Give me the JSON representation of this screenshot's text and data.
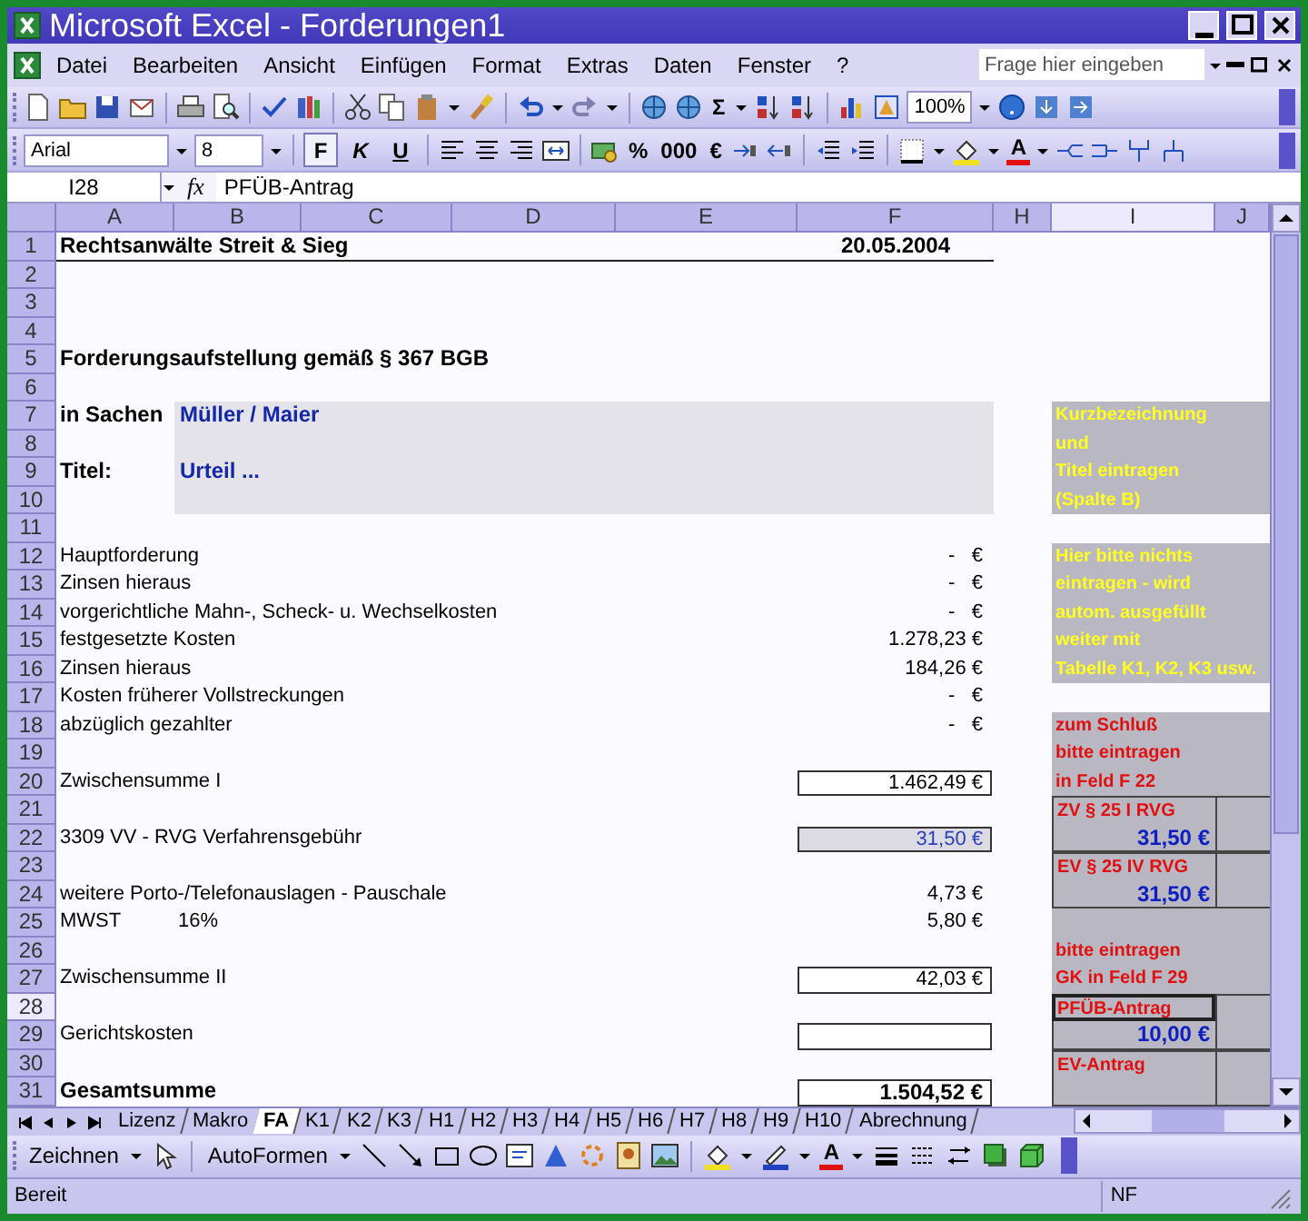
{
  "window": {
    "title": "Microsoft Excel - Forderungen1"
  },
  "menu": [
    "Datei",
    "Bearbeiten",
    "Ansicht",
    "Einfügen",
    "Format",
    "Extras",
    "Daten",
    "Fenster",
    "?"
  ],
  "help_search": {
    "placeholder": "Frage hier eingeben"
  },
  "standard_toolbar": {
    "sum": "Σ",
    "zoom": "100%"
  },
  "formatting_toolbar": {
    "font": "Arial",
    "size": "8",
    "bold": "F",
    "italic": "K",
    "underline": "U",
    "percent": "%",
    "thousands": "000",
    "euro": "€",
    "font_color": "A"
  },
  "formula_bar": {
    "cell": "I28",
    "fx": "fx",
    "content": "PFÜB-Antrag"
  },
  "sheet": {
    "columns": [
      {
        "label": "A",
        "selected": false
      },
      {
        "label": "B",
        "selected": false
      },
      {
        "label": "C",
        "selected": false
      },
      {
        "label": "D",
        "selected": false
      },
      {
        "label": "E",
        "selected": false
      },
      {
        "label": "F",
        "selected": false
      },
      {
        "label": "H",
        "selected": false
      },
      {
        "label": "I",
        "selected": true
      },
      {
        "label": "J",
        "selected": false
      }
    ],
    "rows": [
      {
        "label": "1",
        "selected": false,
        "a": {
          "text": "Rechtsanwälte Streit & Sieg",
          "kind": "title"
        },
        "f": {
          "text": "20.05.2004",
          "kind": "date"
        }
      },
      {
        "label": "2",
        "selected": false
      },
      {
        "label": "3",
        "selected": false
      },
      {
        "label": "4",
        "selected": false
      },
      {
        "label": "5",
        "selected": false,
        "a": {
          "text": "Forderungsaufstellung gemäß § 367 BGB",
          "kind": "bold"
        }
      },
      {
        "label": "6",
        "selected": false
      },
      {
        "label": "7",
        "selected": false,
        "a": {
          "text": "in Sachen",
          "kind": "bold"
        },
        "b": {
          "text": "Müller / Maier",
          "kind": "entry"
        },
        "i": {
          "text": "Kurzbezeichnung",
          "kind": "yellow"
        }
      },
      {
        "label": "8",
        "selected": false,
        "b": {
          "kind": "entry"
        },
        "i": {
          "text": "und",
          "kind": "yellow"
        }
      },
      {
        "label": "9",
        "selected": false,
        "a": {
          "text": "Titel:",
          "kind": "bold"
        },
        "b": {
          "text": "Urteil ...",
          "kind": "entry"
        },
        "i": {
          "text": "Titel eintragen",
          "kind": "yellow"
        }
      },
      {
        "label": "10",
        "selected": false,
        "b": {
          "kind": "entry"
        },
        "i": {
          "text": "(Spalte B)",
          "kind": "yellow"
        }
      },
      {
        "label": "11",
        "selected": false
      },
      {
        "label": "12",
        "selected": false,
        "a": {
          "text": "Hauptforderung",
          "kind": "plain"
        },
        "f": {
          "text": "-   €",
          "kind": "value"
        },
        "i": {
          "text": "Hier bitte nichts",
          "kind": "yellow"
        }
      },
      {
        "label": "13",
        "selected": false,
        "a": {
          "text": "Zinsen hieraus",
          "kind": "plain"
        },
        "f": {
          "text": "-   €",
          "kind": "value"
        },
        "i": {
          "text": "eintragen - wird",
          "kind": "yellow"
        }
      },
      {
        "label": "14",
        "selected": false,
        "a": {
          "text": "vorgerichtliche Mahn-, Scheck- u. Wechselkosten",
          "kind": "plain"
        },
        "f": {
          "text": "-   €",
          "kind": "value"
        },
        "i": {
          "text": "autom. ausgefüllt",
          "kind": "yellow"
        }
      },
      {
        "label": "15",
        "selected": false,
        "a": {
          "text": "festgesetzte Kosten",
          "kind": "plain"
        },
        "f": {
          "text": "1.278,23 €",
          "kind": "value"
        },
        "i": {
          "text": "weiter mit",
          "kind": "yellow"
        }
      },
      {
        "label": "16",
        "selected": false,
        "a": {
          "text": "Zinsen hieraus",
          "kind": "plain"
        },
        "f": {
          "text": "184,26 €",
          "kind": "value"
        },
        "i": {
          "text": "Tabelle K1, K2, K3 usw.",
          "kind": "yellow"
        }
      },
      {
        "label": "17",
        "selected": false,
        "a": {
          "text": "Kosten früherer Vollstreckungen",
          "kind": "plain"
        },
        "f": {
          "text": "-   €",
          "kind": "value"
        }
      },
      {
        "label": "18",
        "selected": false,
        "a": {
          "text": "abzüglich gezahlter",
          "kind": "plain"
        },
        "f": {
          "text": "-   €",
          "kind": "value"
        },
        "i": {
          "text": "zum Schluß",
          "kind": "red"
        }
      },
      {
        "label": "19",
        "selected": false,
        "i": {
          "text": "bitte eintragen",
          "kind": "red"
        }
      },
      {
        "label": "20",
        "selected": false,
        "a": {
          "text": "Zwischensumme I",
          "kind": "plain"
        },
        "f": {
          "text": "1.462,49 €",
          "kind": "boxed"
        },
        "i": {
          "text": "in Feld F 22",
          "kind": "red"
        }
      },
      {
        "label": "21",
        "selected": false,
        "i": {
          "text": "ZV § 25 I RVG",
          "kind": "box_label"
        }
      },
      {
        "label": "22",
        "selected": false,
        "a": {
          "text": "3309 VV - RVG Verfahrensgebühr",
          "kind": "plain"
        },
        "f": {
          "text": "31,50 €",
          "kind": "boxed_shaded"
        },
        "i": {
          "text": "31,50 €",
          "kind": "box_amount"
        }
      },
      {
        "label": "23",
        "selected": false,
        "i": {
          "text": "EV § 25 IV RVG",
          "kind": "box_label"
        }
      },
      {
        "label": "24",
        "selected": false,
        "a": {
          "text": "weitere Porto-/Telefonauslagen - Pauschale",
          "kind": "plain"
        },
        "f": {
          "text": "4,73 €",
          "kind": "value"
        },
        "i": {
          "text": "31,50 €",
          "kind": "box_amount"
        }
      },
      {
        "label": "25",
        "selected": false,
        "a": {
          "text": "MWST",
          "kind": "plain"
        },
        "b": {
          "text": "16%",
          "kind": "plain"
        },
        "f": {
          "text": "5,80 €",
          "kind": "value"
        },
        "i": {
          "kind": "red"
        }
      },
      {
        "label": "26",
        "selected": false,
        "i": {
          "text": "bitte eintragen",
          "kind": "red"
        }
      },
      {
        "label": "27",
        "selected": false,
        "a": {
          "text": "Zwischensumme II",
          "kind": "plain"
        },
        "f": {
          "text": "42,03 €",
          "kind": "boxed"
        },
        "i": {
          "text": "GK in Feld F 29",
          "kind": "red"
        }
      },
      {
        "label": "28",
        "selected": true,
        "i": {
          "text": "PFÜB-Antrag",
          "kind": "box_label"
        }
      },
      {
        "label": "29",
        "selected": false,
        "a": {
          "text": "Gerichtskosten",
          "kind": "plain"
        },
        "f": {
          "kind": "boxed"
        },
        "i": {
          "text": "10,00 €",
          "kind": "box_amount"
        }
      },
      {
        "label": "30",
        "selected": false,
        "i": {
          "text": "EV-Antrag",
          "kind": "box_label"
        }
      },
      {
        "label": "31",
        "selected": false,
        "a": {
          "text": "Gesamtsumme",
          "kind": "bold"
        },
        "f": {
          "text": "1.504,52 €",
          "kind": "boxed_bold"
        },
        "i": {
          "kind": "box_amount"
        }
      }
    ]
  },
  "sheet_tabs": [
    {
      "label": "Lizenz",
      "selected": false
    },
    {
      "label": "Makro",
      "selected": false
    },
    {
      "label": "FA",
      "selected": true
    },
    {
      "label": "K1",
      "selected": false
    },
    {
      "label": "K2",
      "selected": false
    },
    {
      "label": "K3",
      "selected": false
    },
    {
      "label": "H1",
      "selected": false
    },
    {
      "label": "H2",
      "selected": false
    },
    {
      "label": "H3",
      "selected": false
    },
    {
      "label": "H4",
      "selected": false
    },
    {
      "label": "H5",
      "selected": false
    },
    {
      "label": "H6",
      "selected": false
    },
    {
      "label": "H7",
      "selected": false
    },
    {
      "label": "H8",
      "selected": false
    },
    {
      "label": "H9",
      "selected": false
    },
    {
      "label": "H10",
      "selected": false
    },
    {
      "label": "Abrechnung",
      "selected": false
    }
  ],
  "drawing_toolbar": {
    "draw": "Zeichnen",
    "autoshapes": "AutoFormen",
    "font_color": "A"
  },
  "status_bar": {
    "left": "Bereit",
    "right": "NF"
  }
}
